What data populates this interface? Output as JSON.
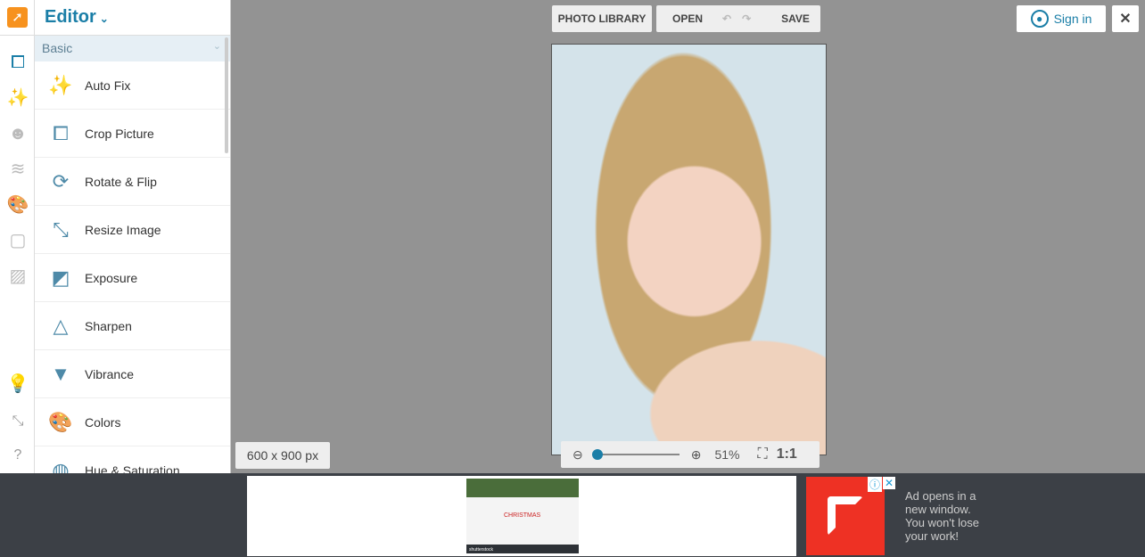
{
  "app": {
    "title": "Editor"
  },
  "panel": {
    "category": "Basic",
    "items": [
      {
        "label": "Auto Fix"
      },
      {
        "label": "Crop Picture"
      },
      {
        "label": "Rotate & Flip"
      },
      {
        "label": "Resize Image"
      },
      {
        "label": "Exposure"
      },
      {
        "label": "Sharpen"
      },
      {
        "label": "Vibrance"
      },
      {
        "label": "Colors"
      },
      {
        "label": "Hue & Saturation"
      }
    ]
  },
  "toolbar": {
    "photo_library": "PHOTO LIBRARY",
    "open": "OPEN",
    "save": "SAVE",
    "sign_in": "Sign in",
    "close": "✕"
  },
  "status": {
    "dimensions": "600 x 900 px",
    "zoom_percent": "51%",
    "zoom_value": 51,
    "one_to_one": "1:1"
  },
  "ad": {
    "notice": "Ad opens in a new window. You won't lose your work!",
    "card_text": "CHRISTMAS",
    "brand": "shutterstock"
  },
  "colors": {
    "accent": "#1a7ea7",
    "logo": "#f7921e"
  }
}
